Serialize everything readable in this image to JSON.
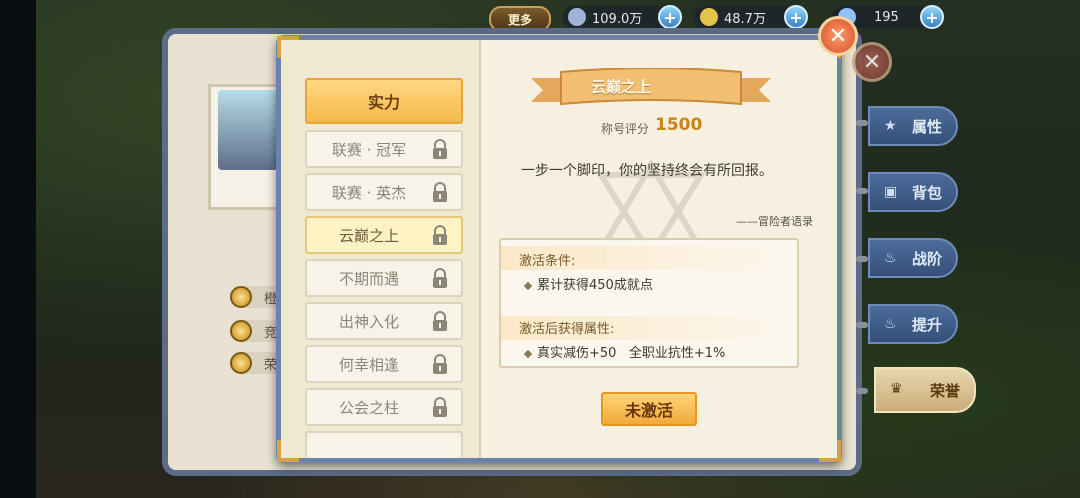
{
  "topbar": {
    "more_label": "更多",
    "resources": [
      {
        "name": "feather",
        "value": "109.0万",
        "color": "#9fb4d6"
      },
      {
        "name": "leaf",
        "value": "48.7万",
        "color": "#e3c34a"
      },
      {
        "name": "gem",
        "value": "195",
        "color": "#8fc0ff"
      }
    ]
  },
  "background_panel": {
    "items": [
      "橙",
      "竞",
      "荣"
    ]
  },
  "side_tabs": [
    {
      "label": "属性",
      "icon": "star-icon"
    },
    {
      "label": "背包",
      "icon": "bag-icon"
    },
    {
      "label": "战阶",
      "icon": "flame-icon"
    },
    {
      "label": "提升",
      "icon": "flame-icon"
    },
    {
      "label": "荣誉",
      "icon": "trophy-icon",
      "active": true
    }
  ],
  "title_list": {
    "header": "实力",
    "items": [
      {
        "label": "联赛 · 冠军",
        "locked": true
      },
      {
        "label": "联赛 · 英杰",
        "locked": true
      },
      {
        "label": "云巅之上",
        "locked": true,
        "selected": true
      },
      {
        "label": "不期而遇",
        "locked": true
      },
      {
        "label": "出神入化",
        "locked": true
      },
      {
        "label": "何幸相逢",
        "locked": true
      },
      {
        "label": "公会之柱",
        "locked": true
      }
    ]
  },
  "detail": {
    "title": "云巅之上",
    "score_label": "称号评分",
    "score_value": "1500",
    "quote": "一步一个脚印，你的坚持终会有所回报。",
    "author": "——冒险者语录",
    "condition_title": "激活条件:",
    "condition_text": "累计获得450成就点",
    "attr_title": "激活后获得属性:",
    "attr_text": "真实减伤+50   全职业抗性+1%",
    "button_label": "未激活"
  },
  "close_label": "✕"
}
